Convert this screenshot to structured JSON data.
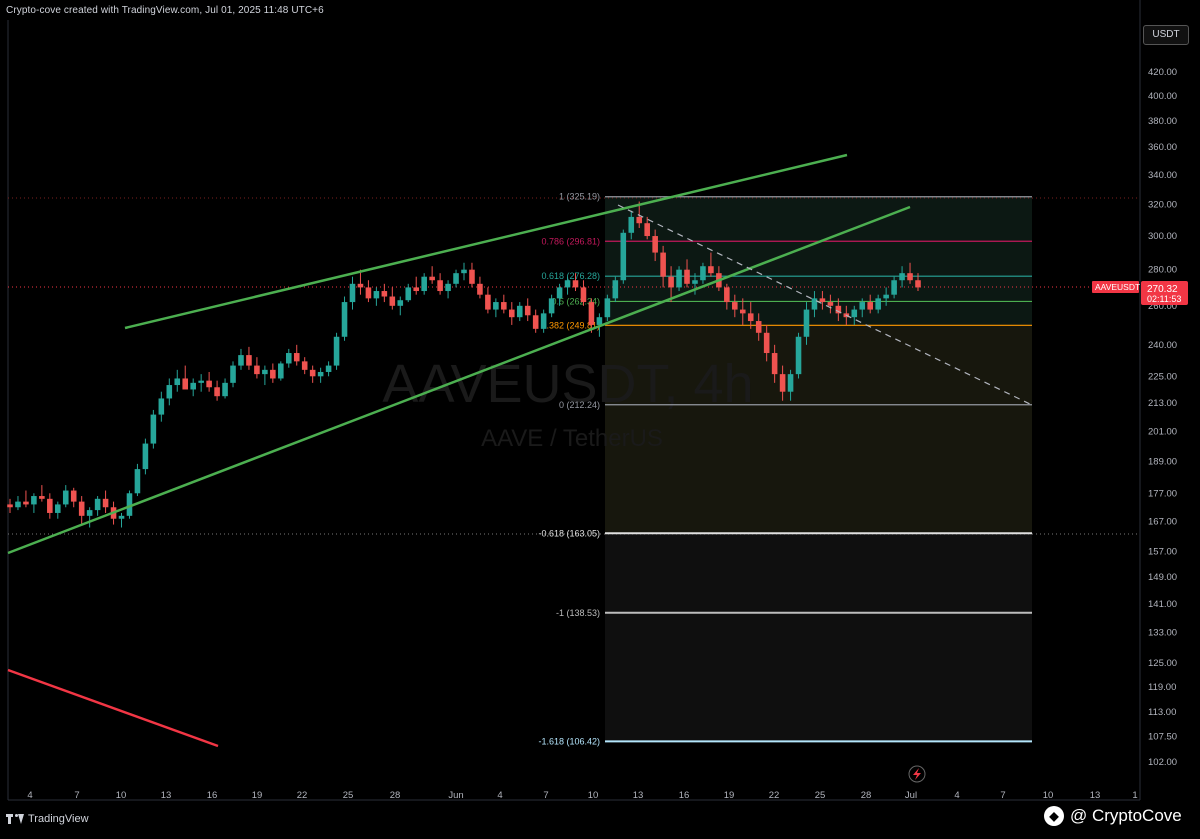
{
  "header": {
    "attribution": "Crypto-cove created with TradingView.com, Jul 01, 2025 11:48 UTC+6",
    "currency_button": "USDT",
    "brand": "TradingView",
    "watermark_user": "@ CryptoCove"
  },
  "chart_data": {
    "type": "candlestick",
    "symbol_watermark": "AAVEUSDT, 4h",
    "symbol_subtitle": "AAVE / TetherUS",
    "price_axis_labels": [
      "420.00",
      "400.00",
      "380.00",
      "360.00",
      "340.00",
      "320.00",
      "300.00",
      "280.00",
      "260.00",
      "240.00",
      "225.00",
      "213.00",
      "201.00",
      "189.00",
      "177.00",
      "167.00",
      "157.00",
      "149.00",
      "141.00",
      "133.00",
      "125.00",
      "119.00",
      "113.00",
      "107.50",
      "102.00"
    ],
    "time_axis_labels": [
      "4",
      "7",
      "10",
      "13",
      "16",
      "19",
      "22",
      "25",
      "28",
      "Jun",
      "4",
      "7",
      "10",
      "13",
      "16",
      "19",
      "22",
      "25",
      "28",
      "Jul",
      "4",
      "7",
      "10",
      "13",
      "1"
    ],
    "last_price": {
      "symbol": "AAVEUSDT",
      "price": "270.32",
      "countdown": "02:11:53"
    },
    "fibonacci_levels": [
      {
        "label": "1 (325.19)",
        "value": 325.19,
        "color": "#9598a1"
      },
      {
        "label": "0.786 (296.81)",
        "value": 296.81,
        "color": "#c2185b"
      },
      {
        "label": "0.618 (276.28)",
        "value": 276.28,
        "color": "#26a69a"
      },
      {
        "label": "0.5 (262.34)",
        "value": 262.34,
        "color": "#4caf50"
      },
      {
        "label": "0.382 (249.81)",
        "value": 249.81,
        "color": "#ff9800"
      },
      {
        "label": "0 (212.24)",
        "value": 212.24,
        "color": "#9598a1"
      },
      {
        "label": "-0.618 (163.05)",
        "value": 163.05,
        "color": "#e0e0e0"
      },
      {
        "label": "-1 (138.53)",
        "value": 138.53,
        "color": "#bdbdbd"
      },
      {
        "label": "-1.618 (106.42)",
        "value": 106.42,
        "color": "#b3e5fc"
      }
    ],
    "candles": [
      [
        173,
        175,
        170,
        172
      ],
      [
        172,
        176,
        171,
        174
      ],
      [
        174,
        178,
        172,
        173
      ],
      [
        173,
        177,
        170,
        176
      ],
      [
        176,
        180,
        174,
        175
      ],
      [
        175,
        177,
        168,
        170
      ],
      [
        170,
        174,
        168,
        173
      ],
      [
        173,
        180,
        172,
        178
      ],
      [
        178,
        179,
        172,
        174
      ],
      [
        174,
        176,
        166,
        169
      ],
      [
        169,
        172,
        165,
        171
      ],
      [
        171,
        176,
        169,
        175
      ],
      [
        175,
        178,
        170,
        172
      ],
      [
        172,
        174,
        166,
        168
      ],
      [
        168,
        170,
        165,
        169
      ],
      [
        169,
        178,
        168,
        177
      ],
      [
        177,
        188,
        176,
        186
      ],
      [
        186,
        198,
        184,
        196
      ],
      [
        196,
        210,
        194,
        208
      ],
      [
        208,
        218,
        205,
        215
      ],
      [
        215,
        224,
        212,
        221
      ],
      [
        221,
        228,
        218,
        224
      ],
      [
        224,
        230,
        220,
        219
      ],
      [
        219,
        224,
        216,
        222
      ],
      [
        222,
        226,
        218,
        223
      ],
      [
        223,
        227,
        218,
        220
      ],
      [
        220,
        223,
        214,
        216
      ],
      [
        216,
        224,
        215,
        222
      ],
      [
        222,
        232,
        220,
        230
      ],
      [
        230,
        238,
        228,
        235
      ],
      [
        235,
        239,
        228,
        230
      ],
      [
        230,
        234,
        224,
        226
      ],
      [
        226,
        230,
        221,
        228
      ],
      [
        228,
        231,
        222,
        224
      ],
      [
        224,
        232,
        223,
        231
      ],
      [
        231,
        238,
        229,
        236
      ],
      [
        236,
        240,
        230,
        232
      ],
      [
        232,
        234,
        226,
        228
      ],
      [
        228,
        230,
        222,
        225
      ],
      [
        225,
        229,
        222,
        227
      ],
      [
        227,
        232,
        225,
        230
      ],
      [
        230,
        246,
        228,
        244
      ],
      [
        244,
        265,
        242,
        262
      ],
      [
        262,
        276,
        258,
        272
      ],
      [
        272,
        280,
        266,
        270
      ],
      [
        270,
        274,
        262,
        264
      ],
      [
        264,
        270,
        260,
        268
      ],
      [
        268,
        272,
        262,
        265
      ],
      [
        265,
        270,
        258,
        260
      ],
      [
        260,
        265,
        255,
        263
      ],
      [
        263,
        272,
        262,
        270
      ],
      [
        270,
        276,
        266,
        268
      ],
      [
        268,
        278,
        266,
        276
      ],
      [
        276,
        282,
        272,
        274
      ],
      [
        274,
        278,
        266,
        268
      ],
      [
        268,
        274,
        264,
        272
      ],
      [
        272,
        280,
        270,
        278
      ],
      [
        278,
        284,
        274,
        280
      ],
      [
        280,
        284,
        270,
        272
      ],
      [
        272,
        276,
        264,
        266
      ],
      [
        266,
        270,
        256,
        258
      ],
      [
        258,
        264,
        254,
        262
      ],
      [
        262,
        266,
        256,
        258
      ],
      [
        258,
        262,
        250,
        254
      ],
      [
        254,
        262,
        252,
        260
      ],
      [
        260,
        264,
        252,
        255
      ],
      [
        255,
        258,
        246,
        248
      ],
      [
        248,
        258,
        246,
        256
      ],
      [
        256,
        266,
        254,
        264
      ],
      [
        264,
        272,
        260,
        270
      ],
      [
        270,
        276,
        266,
        274
      ],
      [
        274,
        278,
        268,
        270
      ],
      [
        270,
        274,
        260,
        262
      ],
      [
        262,
        264,
        246,
        250
      ],
      [
        250,
        256,
        244,
        254
      ],
      [
        254,
        266,
        252,
        264
      ],
      [
        264,
        276,
        262,
        274
      ],
      [
        274,
        304,
        272,
        302
      ],
      [
        302,
        316,
        298,
        312
      ],
      [
        312,
        322,
        305,
        308
      ],
      [
        308,
        312,
        298,
        300
      ],
      [
        300,
        304,
        285,
        290
      ],
      [
        290,
        294,
        270,
        276
      ],
      [
        276,
        282,
        262,
        270
      ],
      [
        270,
        282,
        268,
        280
      ],
      [
        280,
        286,
        270,
        272
      ],
      [
        272,
        278,
        266,
        274
      ],
      [
        274,
        284,
        272,
        282
      ],
      [
        282,
        290,
        276,
        278
      ],
      [
        278,
        282,
        268,
        270
      ],
      [
        270,
        272,
        258,
        262
      ],
      [
        262,
        266,
        254,
        258
      ],
      [
        258,
        264,
        250,
        256
      ],
      [
        256,
        262,
        248,
        252
      ],
      [
        252,
        256,
        242,
        246
      ],
      [
        246,
        250,
        232,
        236
      ],
      [
        236,
        240,
        222,
        226
      ],
      [
        226,
        230,
        214,
        218
      ],
      [
        218,
        228,
        214,
        226
      ],
      [
        226,
        246,
        224,
        244
      ],
      [
        244,
        262,
        240,
        258
      ],
      [
        258,
        268,
        254,
        264
      ],
      [
        264,
        268,
        258,
        262
      ],
      [
        262,
        266,
        256,
        260
      ],
      [
        260,
        264,
        252,
        256
      ],
      [
        256,
        260,
        250,
        254
      ],
      [
        254,
        260,
        250,
        258
      ],
      [
        258,
        264,
        254,
        262
      ],
      [
        262,
        266,
        256,
        258
      ],
      [
        258,
        266,
        256,
        264
      ],
      [
        264,
        270,
        260,
        266
      ],
      [
        266,
        276,
        264,
        274
      ],
      [
        274,
        282,
        270,
        278
      ],
      [
        278,
        284,
        272,
        274
      ],
      [
        274,
        278,
        268,
        270
      ]
    ]
  },
  "colors": {
    "up": "#26a69a",
    "down": "#ef5350",
    "trendline": "#4caf50",
    "red_trendline": "#f23645",
    "price_tag": "#f23645",
    "grid_hline": "#7a2020"
  }
}
